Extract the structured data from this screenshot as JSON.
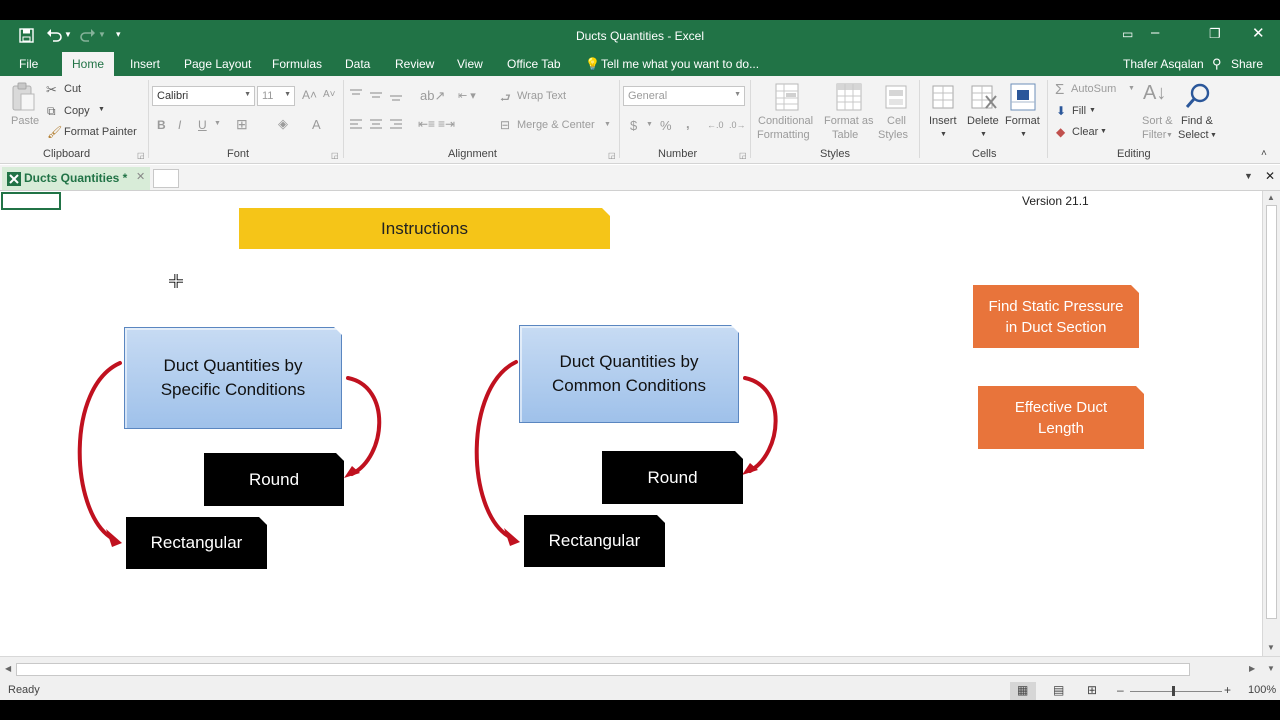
{
  "window": {
    "title": "Ducts Quantities - Excel"
  },
  "qat": {
    "save_icon": "save-icon",
    "undo_icon": "undo-icon",
    "redo_icon": "redo-icon",
    "customize_icon": "customize-qat-icon"
  },
  "menu": {
    "tabs": [
      "File",
      "Home",
      "Insert",
      "Page Layout",
      "Formulas",
      "Data",
      "Review",
      "View",
      "Office Tab"
    ],
    "active_tab": "Home",
    "tell_me": "Tell me what you want to do...",
    "user": "Thafer Asqalan",
    "share": "Share"
  },
  "ribbon": {
    "clipboard": {
      "paste": "Paste",
      "cut": "Cut",
      "copy": "Copy",
      "format_painter": "Format Painter",
      "label": "Clipboard"
    },
    "font": {
      "name": "Calibri",
      "size": "11",
      "bold": "B",
      "italic": "I",
      "underline": "U",
      "label": "Font"
    },
    "alignment": {
      "wrap_text": "Wrap Text",
      "merge_center": "Merge & Center",
      "label": "Alignment"
    },
    "number": {
      "format": "General",
      "currency": "$",
      "percent": "%",
      "comma": ",",
      "label": "Number"
    },
    "styles": {
      "conditional_1": "Conditional",
      "conditional_2": "Formatting",
      "format_table_1": "Format as",
      "format_table_2": "Table",
      "cell_styles_1": "Cell",
      "cell_styles_2": "Styles",
      "label": "Styles"
    },
    "cells": {
      "insert": "Insert",
      "delete": "Delete",
      "format": "Format",
      "label": "Cells"
    },
    "editing": {
      "autosum": "AutoSum",
      "fill": "Fill",
      "clear": "Clear",
      "sort_1": "Sort &",
      "sort_2": "Filter",
      "find_1": "Find &",
      "find_2": "Select",
      "label": "Editing"
    }
  },
  "workbook": {
    "tab_label": "Ducts Quantities *"
  },
  "sheet": {
    "version": "Version 21.1",
    "instructions": "Instructions",
    "left_group": {
      "title": "Duct Quantities by Specific Conditions",
      "round": "Round",
      "rectangular": "Rectangular"
    },
    "right_group": {
      "title": "Duct Quantities by Common Conditions",
      "round": "Round",
      "rectangular": "Rectangular"
    },
    "static_pressure": "Find Static Pressure in Duct Section",
    "effective_length": "Effective Duct Length",
    "colors": {
      "yellow": "#f5c518",
      "blue": "#b2cdee",
      "orange": "#e8743b",
      "arrow": "#c0111f"
    }
  },
  "status": {
    "ready": "Ready",
    "zoom": "100%"
  }
}
